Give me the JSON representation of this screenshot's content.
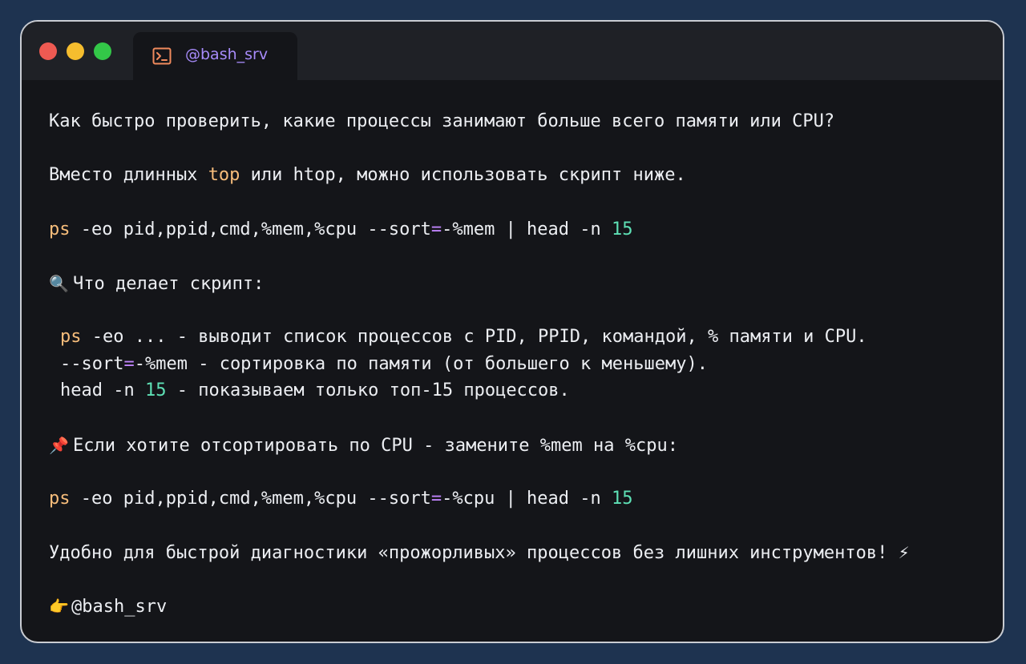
{
  "window": {
    "tab_title": "@bash_srv",
    "tab_icon": "terminal-icon",
    "colors": {
      "close": "#ee5a52",
      "minimize": "#f5bd2e",
      "maximize": "#33c748",
      "tab_label": "#a78bfa",
      "keyword": "#f7bd7b",
      "number": "#5ee0b5",
      "operator": "#c084fc"
    }
  },
  "post": {
    "question": "Как быстро проверить, какие процессы занимают больше всего памяти или CPU?",
    "intro": {
      "before": "Вместо длинных ",
      "kw": "top",
      "after": " или htop, можно использовать скрипт ниже."
    },
    "command1": {
      "cmd": "ps",
      "args1": " -eo pid,ppid,cmd,%mem,%cpu --sort",
      "eq": "=",
      "args2": "-%mem | head -n ",
      "num": "15"
    },
    "what_heading": {
      "icon": "magnifier-icon",
      "glyph": "🔍",
      "text": "Что делает скрипт:"
    },
    "explain": {
      "line1": {
        "kw": "ps",
        "text": " -eo ... - выводит список процессов с PID, PPID, командой, % памяти и CPU."
      },
      "line2": {
        "before": "--sort",
        "eq": "=",
        "text": "-%mem - сортировка по памяти (от большего к меньшему)."
      },
      "line3": {
        "before": "head -n ",
        "num": "15",
        "text": " - показываем только топ-15 процессов."
      }
    },
    "cpu_tip": {
      "icon": "pushpin-icon",
      "glyph": "📌",
      "text": "Если хотите отсортировать по CPU - замените %mem на %cpu:"
    },
    "command2": {
      "cmd": "ps",
      "args1": " -eo pid,ppid,cmd,%mem,%cpu --sort",
      "eq": "=",
      "args2": "-%cpu | head -n ",
      "num": "15"
    },
    "conclusion": {
      "text": "Удобно для быстрой диагностики «прожорливых» процессов без лишних инструментов! ",
      "icon": "lightning-icon",
      "glyph": "⚡"
    },
    "signature": {
      "icon": "pointing-hand-icon",
      "glyph": "👉",
      "text": "@bash_srv"
    }
  }
}
